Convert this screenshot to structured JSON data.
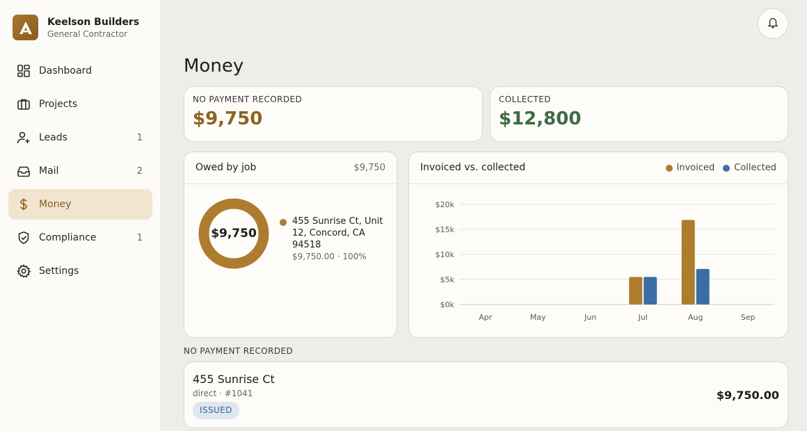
{
  "brand": {
    "name": "Keelson Builders",
    "subtitle": "General Contractor"
  },
  "nav": [
    {
      "label": "Dashboard",
      "icon": "dashboard-icon",
      "count": ""
    },
    {
      "label": "Projects",
      "icon": "briefcase-icon",
      "count": ""
    },
    {
      "label": "Leads",
      "icon": "user-plus-icon",
      "count": "1"
    },
    {
      "label": "Mail",
      "icon": "inbox-icon",
      "count": "2"
    },
    {
      "label": "Money",
      "icon": "dollar-icon",
      "count": "",
      "active": true
    },
    {
      "label": "Compliance",
      "icon": "shield-check-icon",
      "count": "1"
    },
    {
      "label": "Settings",
      "icon": "gear-icon",
      "count": ""
    }
  ],
  "page": {
    "title": "Money"
  },
  "stats": {
    "unpaid": {
      "label": "NO PAYMENT RECORDED",
      "value": "$9,750",
      "color": "#8a6520"
    },
    "collected": {
      "label": "COLLECTED",
      "value": "$12,800",
      "color": "#3e6b45"
    }
  },
  "owed": {
    "title": "Owed by job",
    "total": "$9,750",
    "center": "$9,750",
    "jobs": [
      {
        "name": "455 Sunrise Ct, Unit 12, Concord, CA 94518",
        "meta": "$9,750.00 · 100%",
        "share": 1.0,
        "color": "#ad7c2f"
      }
    ]
  },
  "chart_panel": {
    "title": "Invoiced vs. collected",
    "legend": [
      {
        "label": "Invoiced",
        "color": "#ad7c2f"
      },
      {
        "label": "Collected",
        "color": "#3b6ea5"
      }
    ]
  },
  "chart_data": {
    "type": "bar",
    "categories": [
      "Apr",
      "May",
      "Jun",
      "Jul",
      "Aug",
      "Sep"
    ],
    "series": [
      {
        "name": "Invoiced",
        "values": [
          0,
          0,
          0,
          5500,
          16900,
          0
        ],
        "color": "#ad7c2f"
      },
      {
        "name": "Collected",
        "values": [
          0,
          0,
          0,
          5500,
          7100,
          0
        ],
        "color": "#3b6ea5"
      }
    ],
    "yticks": [
      "$0k",
      "$5k",
      "$10k",
      "$15k",
      "$20k"
    ],
    "ytick_values": [
      0,
      5000,
      10000,
      15000,
      20000
    ],
    "ylim": [
      0,
      20000
    ],
    "grid": true,
    "legend_position": "top-right"
  },
  "unpaid_section": {
    "label": "NO PAYMENT RECORDED",
    "rows": [
      {
        "title": "455 Sunrise Ct",
        "sub": "direct · #1041",
        "status": "ISSUED",
        "amount": "$9,750.00"
      }
    ]
  }
}
